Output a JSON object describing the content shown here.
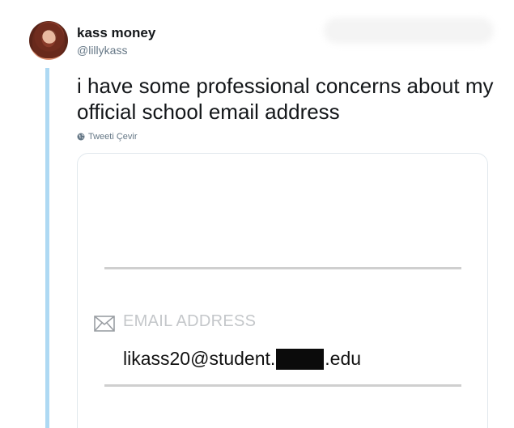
{
  "tweet": {
    "author": {
      "name": "kass money",
      "handle": "@lillykass"
    },
    "text": "i have some professional concerns about my official school email address",
    "translate_label": "Tweeti Çevir"
  },
  "media": {
    "field_label": "EMAIL ADDRESS",
    "email_prefix": "likass20@student.",
    "email_suffix": ".edu",
    "icon": "envelope-icon"
  },
  "colors": {
    "thread_line": "#aed9f3",
    "name": "#14171a",
    "handle": "#657786",
    "label": "#c4c7ca",
    "redaction": "#0b0b0b"
  }
}
